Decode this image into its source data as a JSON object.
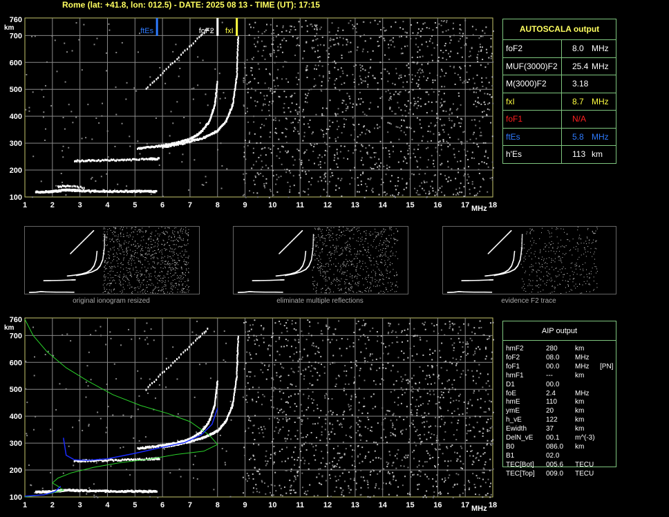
{
  "header": {
    "title": "Rome (lat: +41.8, lon: 012.5) - DATE: 2025 08 13 - TIME (UT): 17:15"
  },
  "colors": {
    "grid": "#8a8a8a",
    "frame": "#c8c86e",
    "table_border": "#7fc77f",
    "trace": "#ffffff",
    "ftEs": "#2e7bff",
    "foF2": "#ffffff",
    "fxI": "#ffff40",
    "foF1": "#ff2020",
    "profile": "#2ad42a",
    "trace_fit": "#1a2cff"
  },
  "autoscala": {
    "title": "AUTOSCALA output",
    "rows": [
      {
        "label": "foF2",
        "value": "8.0",
        "unit": "MHz",
        "color": "#ffffff"
      },
      {
        "label": "MUF(3000)F2",
        "value": "25.4",
        "unit": "MHz",
        "color": "#ffffff"
      },
      {
        "label": "M(3000)F2",
        "value": "3.18",
        "unit": "",
        "color": "#ffffff"
      },
      {
        "label": "fxI",
        "value": "8.7",
        "unit": "MHz",
        "color": "#ffff40"
      },
      {
        "label": "foF1",
        "value": "N/A",
        "unit": "",
        "color": "#ff2020"
      },
      {
        "label": "ftEs",
        "value": "5.8",
        "unit": "MHz",
        "color": "#2e7bff"
      },
      {
        "label": "h'Es",
        "value": "113",
        "unit": "km",
        "color": "#ffffff"
      }
    ]
  },
  "aip": {
    "title": "AIP output",
    "rows": [
      {
        "label": "hmF2",
        "value": "280",
        "unit": "km",
        "extra": ""
      },
      {
        "label": "foF2",
        "value": "08.0",
        "unit": "MHz",
        "extra": ""
      },
      {
        "label": "foF1",
        "value": "00.0",
        "unit": "MHz",
        "extra": "[PN]"
      },
      {
        "label": "hmF1",
        "value": "---",
        "unit": "km",
        "extra": ""
      },
      {
        "label": "D1",
        "value": "00.0",
        "unit": "",
        "extra": ""
      },
      {
        "label": "foE",
        "value": "2.4",
        "unit": "MHz",
        "extra": ""
      },
      {
        "label": "hmE",
        "value": "110",
        "unit": "km",
        "extra": ""
      },
      {
        "label": "ymE",
        "value": "20",
        "unit": "km",
        "extra": ""
      },
      {
        "label": "h_vE",
        "value": "122",
        "unit": "km",
        "extra": ""
      },
      {
        "label": "Ewidth",
        "value": "37",
        "unit": "km",
        "extra": ""
      },
      {
        "label": "DelN_vE",
        "value": "00.1",
        "unit": "m^(-3)",
        "extra": ""
      },
      {
        "label": "B0",
        "value": "086.0",
        "unit": "km",
        "extra": ""
      },
      {
        "label": "B1",
        "value": "02.0",
        "unit": "",
        "extra": ""
      },
      {
        "label": "TEC[Bot]",
        "value": "005.6",
        "unit": "TECU",
        "extra": ""
      },
      {
        "label": "TEC[Top]",
        "value": "009.0",
        "unit": "TECU",
        "extra": ""
      }
    ]
  },
  "thumbnails": [
    {
      "caption": "original ionogram resized"
    },
    {
      "caption": "eliminate multiple reflections"
    },
    {
      "caption": "evidence F2 trace"
    }
  ],
  "chart_data": [
    {
      "type": "scatter",
      "name": "ionogram-top",
      "xlim": [
        1,
        18
      ],
      "ylim": [
        100,
        760
      ],
      "xunit": "MHz",
      "yunit": "km",
      "x_ticks": [
        1,
        2,
        3,
        4,
        5,
        6,
        7,
        8,
        9,
        10,
        11,
        12,
        13,
        14,
        15,
        16,
        17
      ],
      "y_ticks": [
        100,
        200,
        300,
        400,
        500,
        600,
        700,
        760
      ],
      "grid": true,
      "markers": [
        {
          "label": "ftEs",
          "freq": 5.8,
          "color": "#2e7bff"
        },
        {
          "label": "foF2",
          "freq": 8.0,
          "color": "#ffffff"
        },
        {
          "label": "fxI",
          "freq": 8.7,
          "color": "#ffff40"
        }
      ],
      "traces": {
        "es": [
          [
            1.4,
            118
          ],
          [
            2,
            120
          ],
          [
            2.5,
            126
          ],
          [
            3,
            123
          ],
          [
            4,
            121
          ],
          [
            5,
            121
          ],
          [
            5.8,
            120
          ]
        ],
        "es_echo": [
          [
            2.2,
            138
          ],
          [
            2.6,
            142
          ],
          [
            3.2,
            134
          ]
        ],
        "f_low": [
          [
            2.8,
            234
          ],
          [
            3.5,
            235
          ],
          [
            4.5,
            237
          ],
          [
            5.5,
            241
          ],
          [
            5.9,
            242
          ]
        ],
        "f2_o": [
          [
            5.1,
            280
          ],
          [
            5.8,
            288
          ],
          [
            6.5,
            300
          ],
          [
            7.0,
            315
          ],
          [
            7.4,
            340
          ],
          [
            7.7,
            380
          ],
          [
            7.9,
            440
          ],
          [
            8.0,
            530
          ]
        ],
        "f2_x": [
          [
            6.0,
            285
          ],
          [
            6.8,
            300
          ],
          [
            7.5,
            320
          ],
          [
            8.0,
            345
          ],
          [
            8.3,
            380
          ],
          [
            8.55,
            440
          ],
          [
            8.7,
            550
          ],
          [
            8.75,
            700
          ]
        ],
        "f2_multiple": [
          [
            5.4,
            500
          ],
          [
            6.0,
            560
          ],
          [
            6.6,
            620
          ],
          [
            7.2,
            680
          ],
          [
            7.7,
            730
          ]
        ]
      }
    },
    {
      "type": "scatter",
      "name": "ionogram-bottom",
      "xlim": [
        1,
        18
      ],
      "ylim": [
        100,
        760
      ],
      "xunit": "MHz",
      "yunit": "km",
      "x_ticks": [
        1,
        2,
        3,
        4,
        5,
        6,
        7,
        8,
        9,
        10,
        11,
        12,
        13,
        14,
        15,
        16,
        17
      ],
      "y_ticks": [
        100,
        200,
        300,
        400,
        500,
        600,
        700,
        760
      ],
      "grid": true,
      "traces": {
        "es": [
          [
            1.4,
            118
          ],
          [
            2,
            120
          ],
          [
            2.5,
            126
          ],
          [
            3,
            123
          ],
          [
            4,
            121
          ],
          [
            5,
            121
          ],
          [
            5.8,
            120
          ]
        ],
        "f_low": [
          [
            2.8,
            234
          ],
          [
            3.5,
            235
          ],
          [
            4.5,
            237
          ],
          [
            5.5,
            241
          ],
          [
            5.9,
            242
          ]
        ],
        "f2_o": [
          [
            5.1,
            280
          ],
          [
            5.8,
            288
          ],
          [
            6.5,
            300
          ],
          [
            7.0,
            315
          ],
          [
            7.4,
            340
          ],
          [
            7.7,
            380
          ],
          [
            7.9,
            440
          ],
          [
            8.0,
            530
          ]
        ],
        "f2_x": [
          [
            6.0,
            285
          ],
          [
            6.8,
            300
          ],
          [
            7.5,
            320
          ],
          [
            8.0,
            345
          ],
          [
            8.3,
            380
          ],
          [
            8.55,
            440
          ],
          [
            8.7,
            550
          ],
          [
            8.75,
            700
          ]
        ],
        "f2_multiple": [
          [
            5.4,
            500
          ],
          [
            6.0,
            560
          ],
          [
            6.6,
            620
          ],
          [
            7.2,
            680
          ],
          [
            7.7,
            730
          ]
        ]
      },
      "profile": [
        [
          1.0,
          760
        ],
        [
          1.3,
          700
        ],
        [
          1.8,
          640
        ],
        [
          2.5,
          580
        ],
        [
          3.3,
          530
        ],
        [
          4.2,
          480
        ],
        [
          5.2,
          440
        ],
        [
          6.2,
          410
        ],
        [
          7.0,
          380
        ],
        [
          7.7,
          330
        ],
        [
          8.0,
          295
        ],
        [
          7.5,
          270
        ],
        [
          6.5,
          258
        ],
        [
          5.5,
          240
        ],
        [
          4.5,
          228
        ],
        [
          3.5,
          210
        ],
        [
          2.7,
          190
        ],
        [
          2.2,
          170
        ],
        [
          2.0,
          152
        ],
        [
          2.2,
          140
        ],
        [
          2.4,
          125
        ],
        [
          1.8,
          110
        ],
        [
          1.0,
          100
        ]
      ],
      "fit_trace": [
        [
          2.4,
          320
        ],
        [
          2.5,
          255
        ],
        [
          2.8,
          238
        ],
        [
          3.3,
          236
        ],
        [
          4.0,
          242
        ],
        [
          5.0,
          262
        ],
        [
          6.0,
          285
        ],
        [
          6.8,
          302
        ],
        [
          7.4,
          330
        ],
        [
          7.8,
          370
        ],
        [
          8.0,
          430
        ]
      ],
      "e_fit": [
        [
          1.0,
          103
        ],
        [
          1.7,
          108
        ],
        [
          2.1,
          120
        ],
        [
          2.3,
          140
        ]
      ]
    }
  ]
}
